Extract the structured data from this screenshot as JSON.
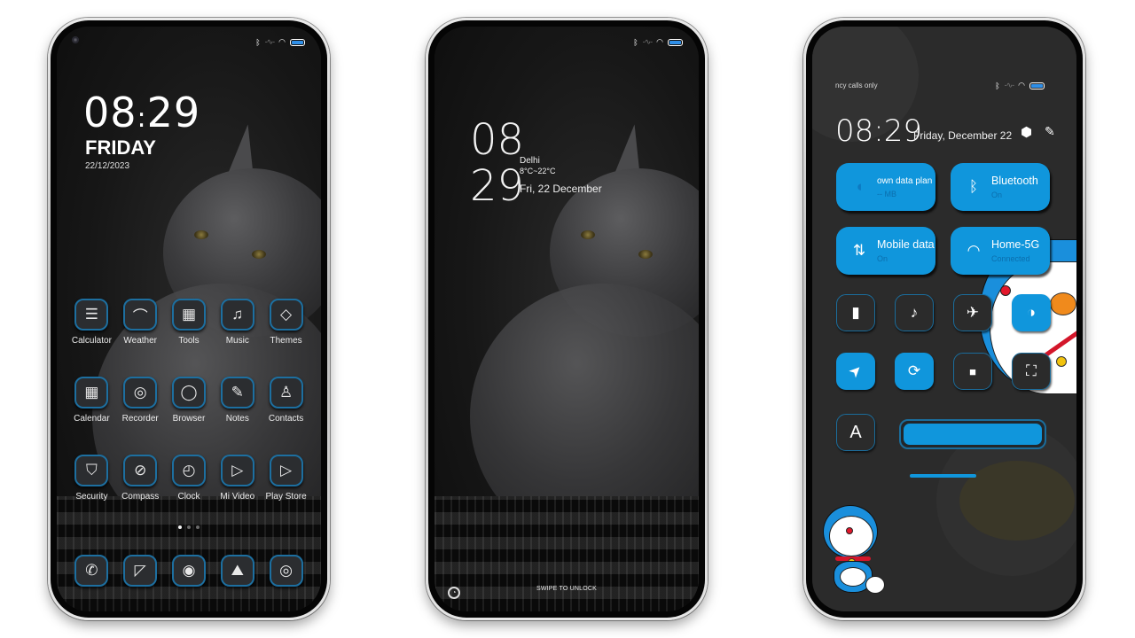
{
  "status_bar": {
    "bluetooth_icon": "bluetooth-icon",
    "signal_icon": "signal-icon",
    "wifi_icon": "wifi-icon",
    "battery_icon": "battery-icon",
    "accent_color": "#2f8fe8"
  },
  "home_screen": {
    "time_hour": "08",
    "time_sep": ":",
    "time_min": "29",
    "day": "FRIDAY",
    "date": "22/12/2023",
    "apps": [
      {
        "label": "Calculator",
        "icon": "calculator-icon",
        "glyph": "☰"
      },
      {
        "label": "Weather",
        "icon": "weather-icon",
        "glyph": "⌒"
      },
      {
        "label": "Tools",
        "icon": "tools-icon",
        "glyph": "▦"
      },
      {
        "label": "Music",
        "icon": "music-icon",
        "glyph": "♫"
      },
      {
        "label": "Themes",
        "icon": "themes-icon",
        "glyph": "◇"
      },
      {
        "label": "Calendar",
        "icon": "calendar-icon",
        "glyph": "▦"
      },
      {
        "label": "Recorder",
        "icon": "recorder-icon",
        "glyph": "◎"
      },
      {
        "label": "Browser",
        "icon": "browser-icon",
        "glyph": "◯"
      },
      {
        "label": "Notes",
        "icon": "notes-icon",
        "glyph": "✎"
      },
      {
        "label": "Contacts",
        "icon": "contacts-icon",
        "glyph": "♙"
      },
      {
        "label": "Security",
        "icon": "security-icon",
        "glyph": "⛉"
      },
      {
        "label": "Compass",
        "icon": "compass-icon",
        "glyph": "⊘"
      },
      {
        "label": "Clock",
        "icon": "clock-icon",
        "glyph": "◴"
      },
      {
        "label": "Mi Video",
        "icon": "mi-video-icon",
        "glyph": "▷"
      },
      {
        "label": "Play Store",
        "icon": "play-store-icon",
        "glyph": "▷"
      }
    ],
    "page_indicator": {
      "pages": 3,
      "current": 1
    },
    "dock": [
      {
        "icon": "phone-icon",
        "glyph": "✆"
      },
      {
        "icon": "messages-icon",
        "glyph": "◸"
      },
      {
        "icon": "camera-app-icon",
        "glyph": "◉"
      },
      {
        "icon": "gallery-icon",
        "glyph": "⛰"
      },
      {
        "icon": "chrome-icon",
        "glyph": "◎"
      }
    ]
  },
  "lock_screen": {
    "hour": "08",
    "minute": "29",
    "city": "Delhi",
    "temperature": "8°C~22°C",
    "date": "Fri, 22 December",
    "swipe_hint": "SWIPE TO UNLOCK",
    "camera_shortcut_icon": "camera-shortcut-icon"
  },
  "control_center": {
    "carrier": "ncy calls only",
    "time": "08:29",
    "date": "Friday, December 22",
    "settings_icon": "settings-icon",
    "edit_icon": "edit-icon",
    "tiles": [
      {
        "title": "own data plan",
        "subtitle": "-- MB",
        "icon": "data-drop-icon",
        "glyph": "💧"
      },
      {
        "title": "Bluetooth",
        "subtitle": "On",
        "icon": "bluetooth-icon",
        "glyph": "ᛒ"
      },
      {
        "title": "Mobile data",
        "subtitle": "On",
        "icon": "mobile-data-icon",
        "glyph": "⇅"
      },
      {
        "title": "Home-5G",
        "subtitle": "Connected",
        "icon": "wifi-icon",
        "glyph": "◠"
      }
    ],
    "toggles": [
      {
        "name": "flashlight",
        "icon": "flashlight-icon",
        "glyph": "▮",
        "on": false
      },
      {
        "name": "silent",
        "icon": "bell-icon",
        "glyph": "🔔",
        "on": false
      },
      {
        "name": "airplane",
        "icon": "airplane-icon",
        "glyph": "✈",
        "on": false
      },
      {
        "name": "dark-mode",
        "icon": "dark-mode-icon",
        "glyph": "◑",
        "on": true
      },
      {
        "name": "location",
        "icon": "location-icon",
        "glyph": "➤",
        "on": true
      },
      {
        "name": "rotation-lock",
        "icon": "rotation-lock-icon",
        "glyph": "⟳",
        "on": true
      },
      {
        "name": "screen-record",
        "icon": "video-camera-icon",
        "glyph": "■",
        "on": false
      },
      {
        "name": "scanner",
        "icon": "scanner-icon",
        "glyph": "⛶",
        "on": false
      }
    ],
    "auto_brightness_label": "A",
    "brightness_percent": 100,
    "accent_color": "#1096dc"
  }
}
